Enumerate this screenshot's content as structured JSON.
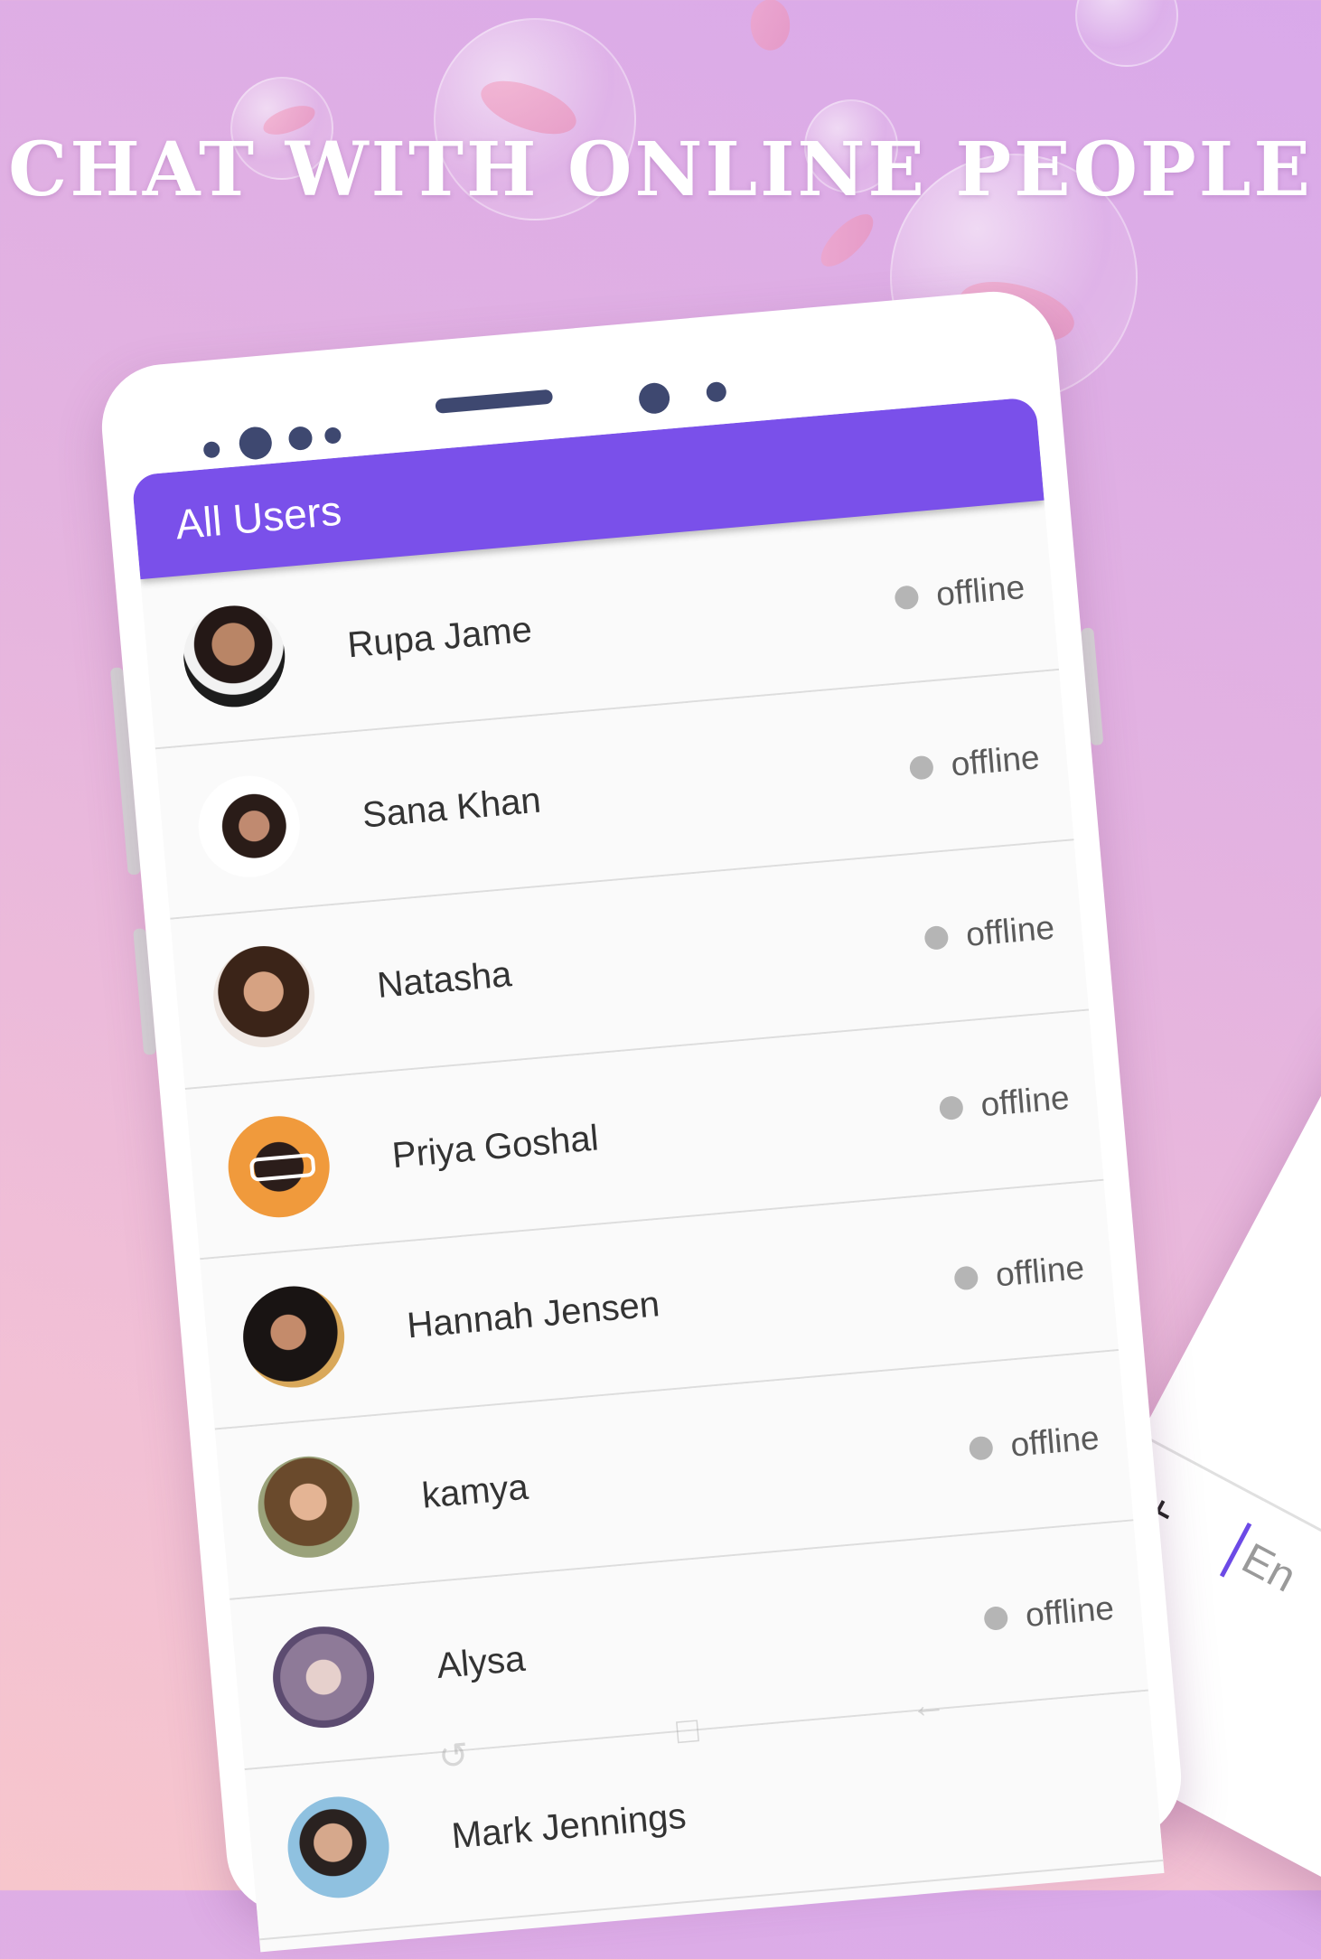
{
  "headline": "CHAT WITH ONLINE PEOPLE",
  "app": {
    "title": "All Users"
  },
  "users": [
    {
      "name": "Rupa Jame",
      "status": "offline"
    },
    {
      "name": "Sana Khan",
      "status": "offline"
    },
    {
      "name": "Natasha",
      "status": "offline"
    },
    {
      "name": "Priya Goshal",
      "status": "offline"
    },
    {
      "name": "Hannah Jensen",
      "status": "offline"
    },
    {
      "name": "kamya",
      "status": "offline"
    },
    {
      "name": "Alysa",
      "status": "offline"
    },
    {
      "name": "Mark Jennings",
      "status": ""
    }
  ],
  "second_phone": {
    "input_placeholder": "En",
    "add_symbol": "+"
  },
  "colors": {
    "accent": "#7a50ea",
    "status_offline": "#b5b5b5",
    "background_top": "#d9a9ea",
    "background_bottom": "#f7c6cc"
  }
}
